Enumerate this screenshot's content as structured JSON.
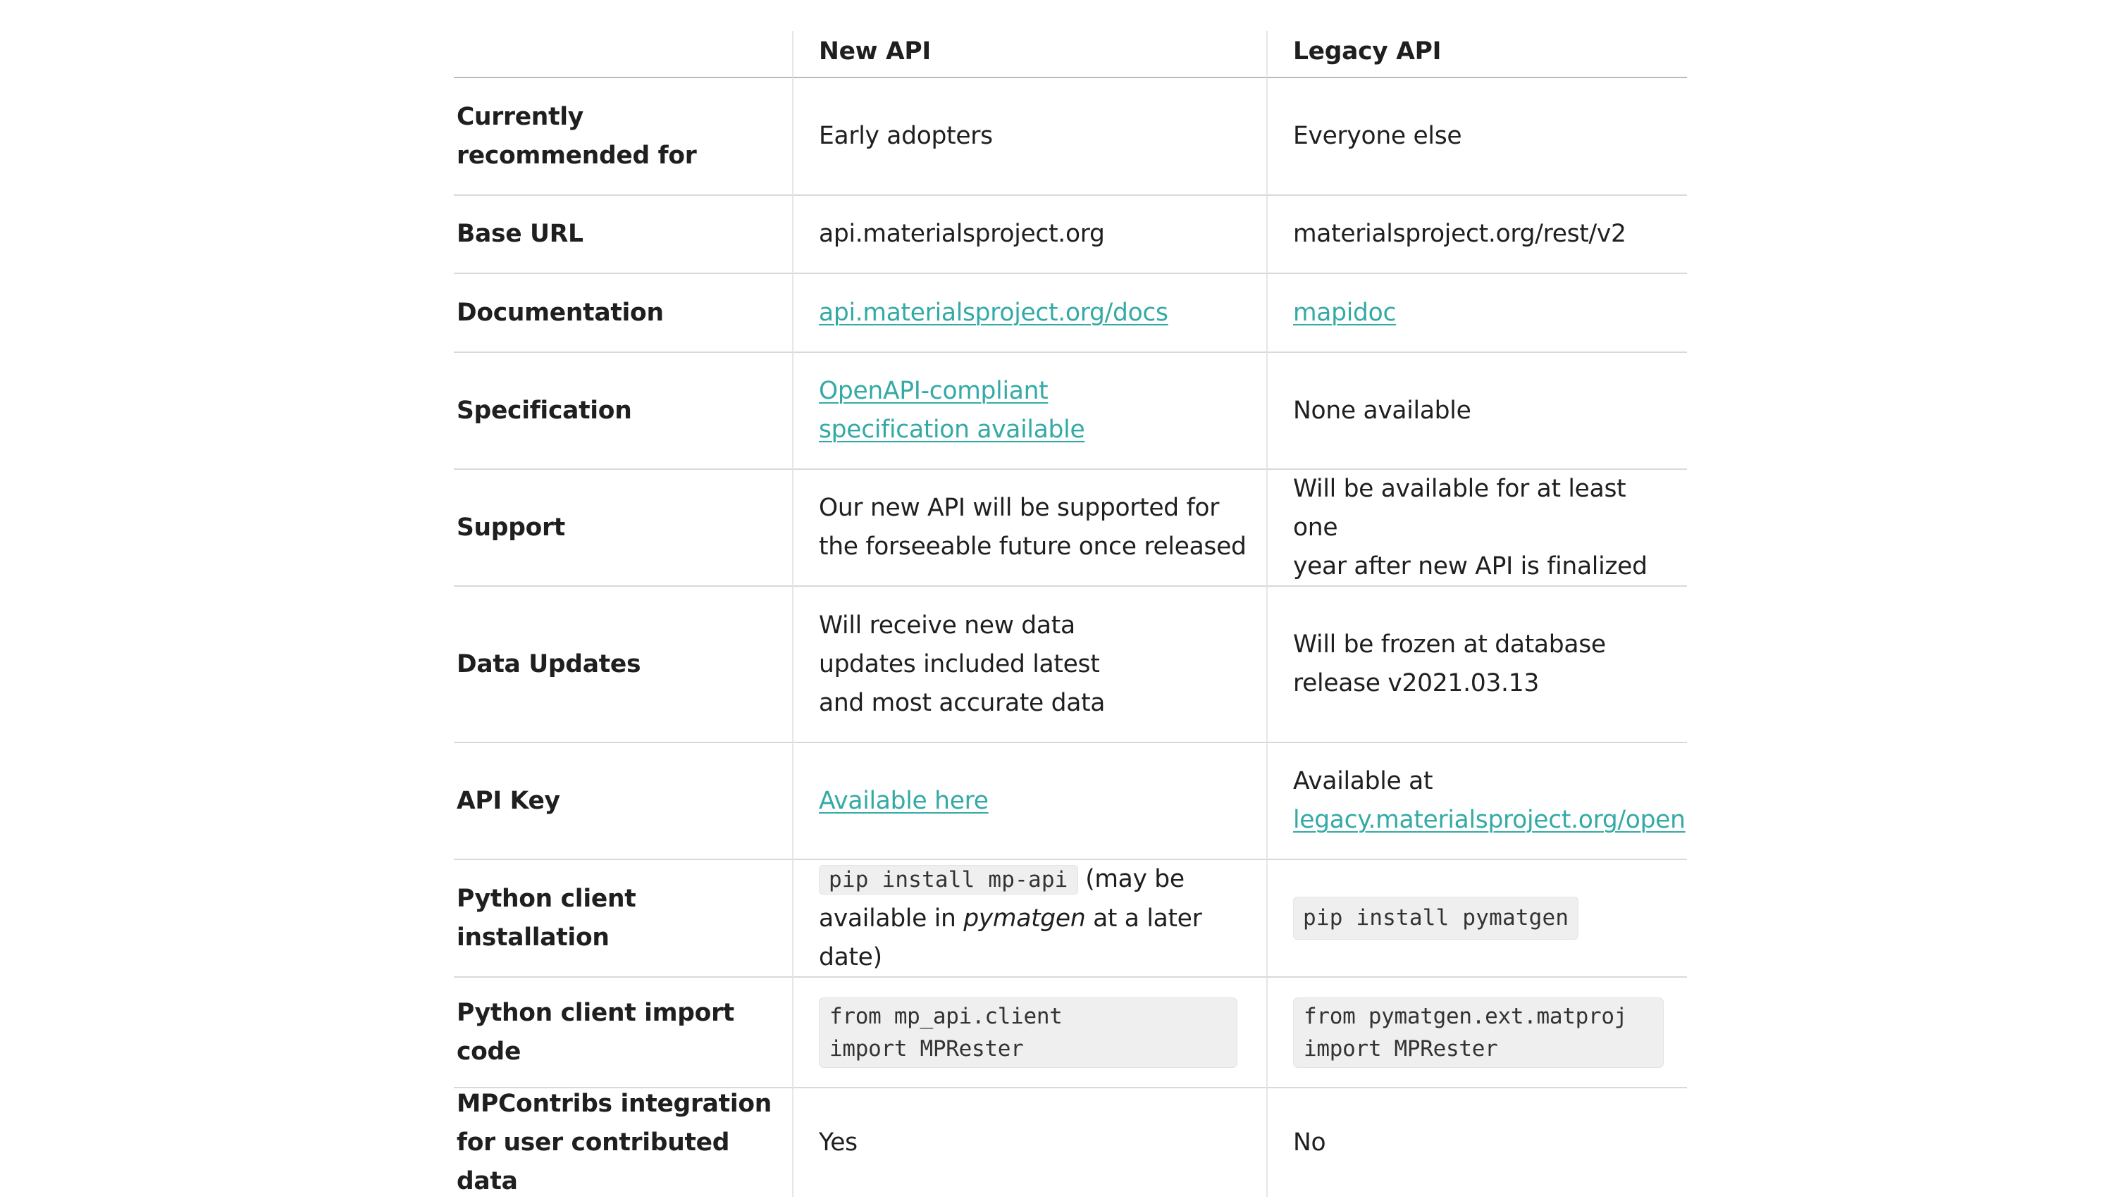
{
  "header": {
    "col0": "",
    "col1": "New API",
    "col2": "Legacy API"
  },
  "rows": {
    "recommended": {
      "label_line1": "Currently",
      "label_line2": "recommended for",
      "new": "Early adopters",
      "legacy": "Everyone else"
    },
    "base_url": {
      "label": "Base URL",
      "new": "api.materialsproject.org",
      "legacy": "materialsproject.org/rest/v2"
    },
    "documentation": {
      "label": "Documentation",
      "new_link": "api.materialsproject.org/docs",
      "legacy_link": "mapidoc"
    },
    "specification": {
      "label": "Specification",
      "new_link_line1": "OpenAPI-compliant ",
      "new_link_line2": "specification available",
      "legacy": "None available"
    },
    "support": {
      "label": "Support",
      "new_line1": "Our new API will be supported for",
      "new_line2": "the forseeable future once released",
      "legacy_line1": "Will be available for at least one",
      "legacy_line2": "year after new API is finalized"
    },
    "data_updates": {
      "label": "Data Updates",
      "new_line1": "Will receive new data",
      "new_line2": "updates included latest",
      "new_line3": "and most accurate data",
      "legacy_line1": "Will be frozen at database",
      "legacy_line2": "release v2021.03.13"
    },
    "api_key": {
      "label": "API Key",
      "new_link": "Available here ",
      "legacy_line1": "Available at",
      "legacy_link": "legacy.materialsproject.org/open"
    },
    "install": {
      "label": "Python client installation",
      "new_code": "pip install mp-api",
      "new_after_code": " (may be",
      "new_line2_before": "available in ",
      "new_line2_em": "pymatgen",
      "new_line2_after": " at a later date)",
      "legacy_code": "pip install pymatgen"
    },
    "import": {
      "label": "Python client import code",
      "new_code_line1": "from mp_api.client",
      "new_code_line2": "import MPRester",
      "legacy_code_line1": "from pymatgen.ext.matproj",
      "legacy_code_line2": "import MPRester"
    },
    "mpcontribs": {
      "label_line1": "MPContribs integration",
      "label_line2": "for user contributed data",
      "new": "Yes",
      "legacy": "No"
    }
  }
}
